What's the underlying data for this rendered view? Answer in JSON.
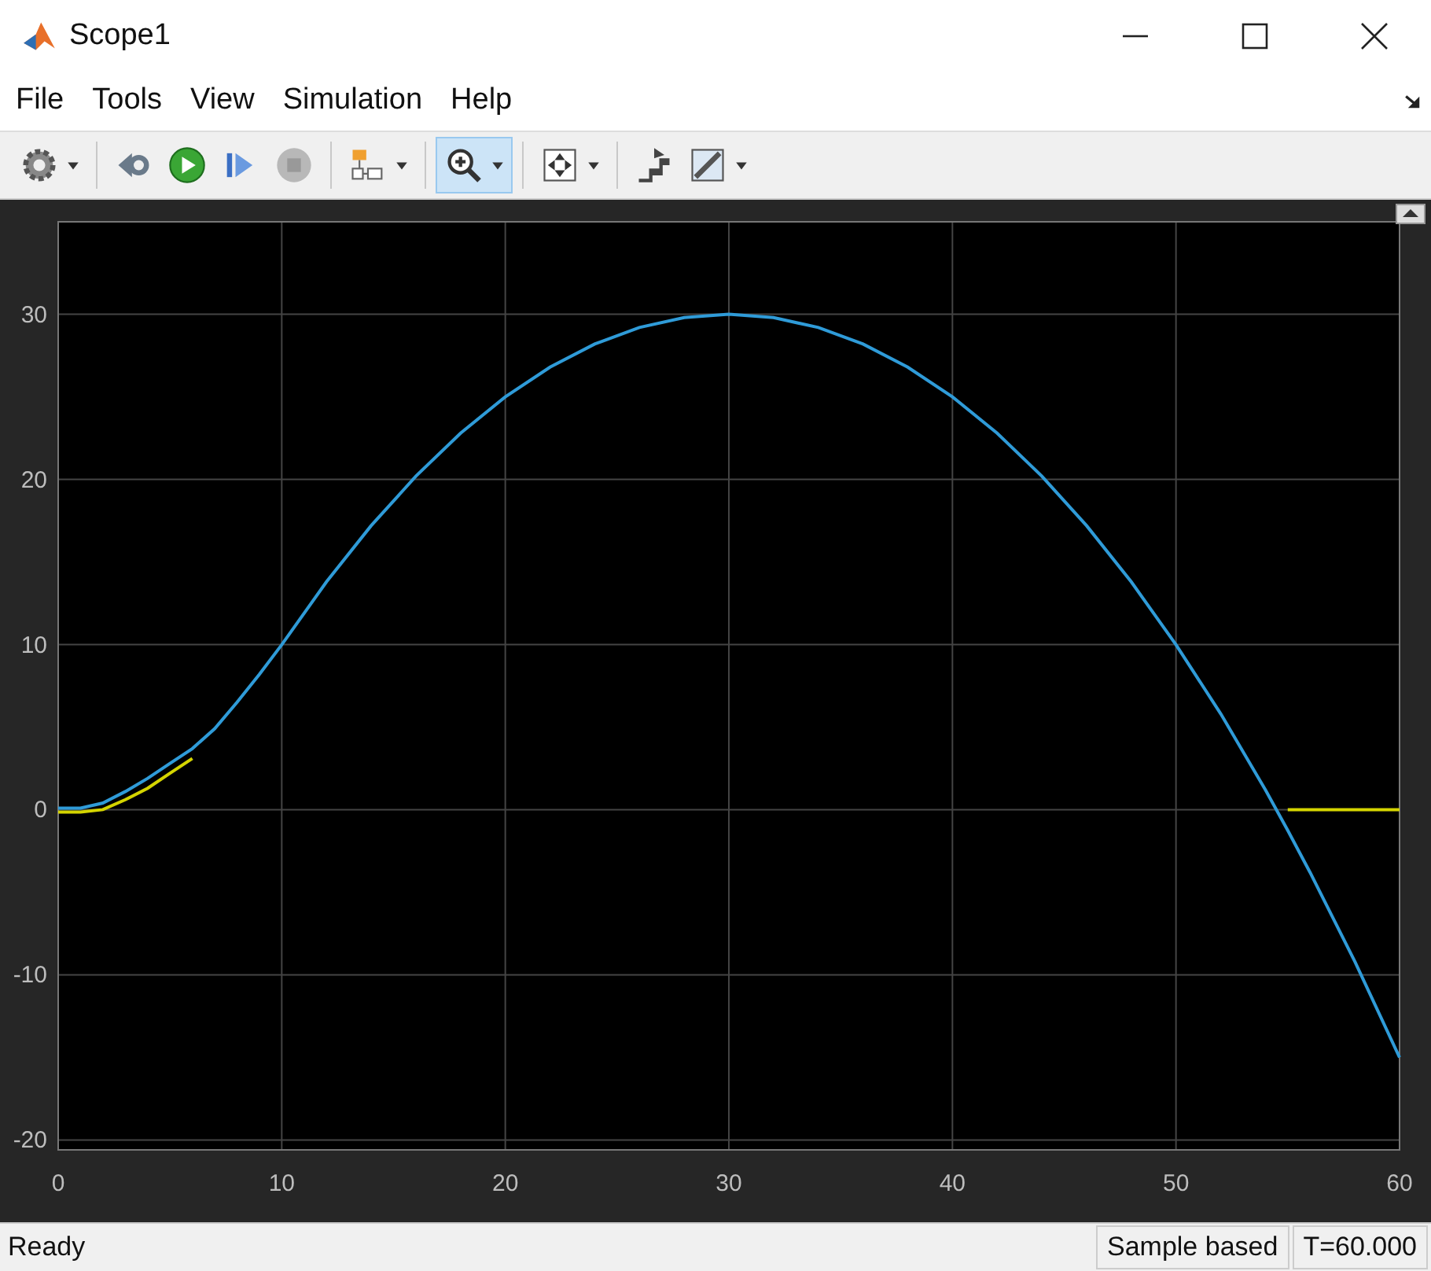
{
  "window": {
    "title": "Scope1"
  },
  "menu": [
    "File",
    "Tools",
    "View",
    "Simulation",
    "Help"
  ],
  "toolbar": [
    {
      "kind": "gear",
      "dropdown": true,
      "selected": false
    },
    {
      "kind": "step-back",
      "dropdown": false,
      "selected": false
    },
    {
      "kind": "run",
      "dropdown": false,
      "selected": false
    },
    {
      "kind": "step-forward",
      "dropdown": false,
      "selected": false
    },
    {
      "kind": "stop",
      "dropdown": false,
      "selected": false
    },
    {
      "kind": "blocks",
      "dropdown": true,
      "selected": false
    },
    {
      "kind": "zoom",
      "dropdown": true,
      "selected": true
    },
    {
      "kind": "fit",
      "dropdown": true,
      "selected": false
    },
    {
      "kind": "stairs",
      "dropdown": false,
      "selected": false
    },
    {
      "kind": "ruler",
      "dropdown": true,
      "selected": false
    }
  ],
  "chart_data": {
    "type": "line",
    "x": [
      0,
      1,
      2,
      3,
      4,
      5,
      6,
      7,
      8,
      9,
      10,
      12,
      14,
      16,
      18,
      20,
      22,
      24,
      26,
      28,
      30,
      32,
      34,
      36,
      38,
      40,
      42,
      44,
      46,
      48,
      50,
      52,
      54,
      55,
      56,
      58,
      60
    ],
    "series": [
      {
        "color": "#d4d400",
        "values": [
          -0.15,
          -0.15,
          0,
          0.6,
          1.3,
          2.2,
          3.1,
          null,
          null,
          null,
          null,
          null,
          null,
          null,
          null,
          null,
          null,
          null,
          null,
          null,
          null,
          null,
          null,
          null,
          null,
          null,
          null,
          null,
          null,
          null,
          null,
          null,
          null,
          0,
          0,
          0,
          0
        ]
      },
      {
        "color": "#2f9bd8",
        "values": [
          0.1,
          0.1,
          0.4,
          1.1,
          1.9,
          2.8,
          3.7,
          4.9,
          6.5,
          8.2,
          10,
          13.8,
          17.2,
          20.2,
          22.8,
          25,
          26.8,
          28.2,
          29.2,
          29.8,
          30,
          29.8,
          29.2,
          28.2,
          26.8,
          25,
          22.8,
          20.2,
          17.2,
          13.8,
          10,
          5.8,
          1.2,
          -1.25,
          -3.8,
          -9.2,
          -15
        ]
      }
    ],
    "grid": true,
    "xlim": [
      0,
      60
    ],
    "ylim": [
      -20.6,
      35.6
    ],
    "xticks": [
      0,
      10,
      20,
      30,
      40,
      50,
      60
    ],
    "yticks": [
      -20,
      -10,
      0,
      10,
      20,
      30
    ]
  },
  "status_bar": {
    "message": "Ready",
    "mode": "Sample based",
    "time": "T=60.000"
  }
}
